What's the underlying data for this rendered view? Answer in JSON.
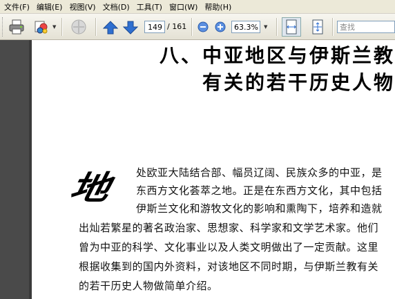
{
  "menu": [
    {
      "label": "文件(F)"
    },
    {
      "label": "编辑(E)"
    },
    {
      "label": "视图(V)"
    },
    {
      "label": "文档(D)"
    },
    {
      "label": "工具(T)"
    },
    {
      "label": "窗口(W)"
    },
    {
      "label": "帮助(H)"
    }
  ],
  "toolbar": {
    "page_current": "149",
    "page_total": "/ 161",
    "zoom": "63.3%",
    "search_placeholder": "查找"
  },
  "colors": {
    "accent_blue": "#2f6fd0",
    "toolbar_bg": "#ece9d8",
    "side_panel": "#4a4a4a"
  },
  "document": {
    "title_line1": "八、中亚地区与伊斯兰教",
    "title_line2": "有关的若干历史人物",
    "drop_cap": "地",
    "lines": [
      "处欧亚大陆结合部、幅员辽阔、民族众多的中亚，是",
      "东西方文化荟萃之地。正是在东西方文化，其中包括",
      "伊斯兰文化和游牧文化的影响和熏陶下，培养和造就",
      "出灿若繁星的著名政治家、思想家、科学家和文学艺术家。他们",
      "曾为中亚的科学、文化事业以及人类文明做出了一定贡献。这里",
      "根据收集到的国内外资料，对该地区不同时期，与伊斯兰教有关",
      "的若干历史人物做简单介绍。"
    ]
  }
}
